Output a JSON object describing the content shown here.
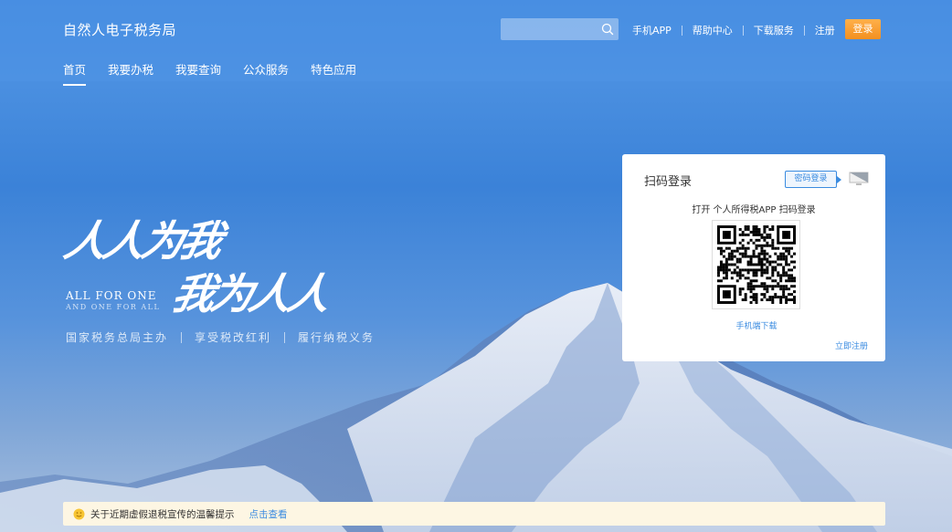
{
  "header": {
    "site_title": "自然人电子税务局",
    "search_placeholder": "",
    "links": [
      "手机APP",
      "帮助中心",
      "下载服务",
      "注册"
    ],
    "login_label": "登录"
  },
  "nav": {
    "tabs": [
      {
        "label": "首页",
        "active": true
      },
      {
        "label": "我要办税",
        "active": false
      },
      {
        "label": "我要查询",
        "active": false
      },
      {
        "label": "公众服务",
        "active": false
      },
      {
        "label": "特色应用",
        "active": false
      }
    ]
  },
  "slogan": {
    "line1": "人人为我",
    "line2": "我为人人",
    "english1": "ALL FOR ONE",
    "english2": "AND ONE FOR ALL",
    "subtitles": [
      "国家税务总局主办",
      "享受税改红利",
      "履行纳税义务"
    ]
  },
  "login_card": {
    "title": "扫码登录",
    "password_login": "密码登录",
    "scan_hint": "打开 个人所得税APP 扫码登录",
    "mobile_download": "手机端下载",
    "register": "立即注册"
  },
  "notice": {
    "text": "关于近期虚假退税宣传的温馨提示",
    "link": "点击查看"
  },
  "colors": {
    "accent": "#3a8be0",
    "login_button": "#f39020",
    "notice_bg": "#fdf6e3"
  }
}
